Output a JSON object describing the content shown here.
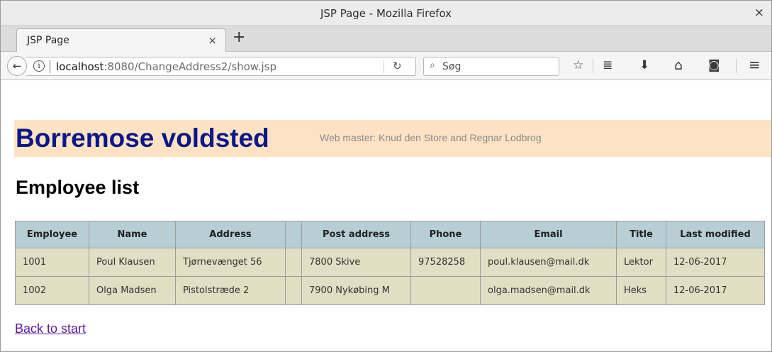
{
  "window": {
    "title": "JSP Page - Mozilla Firefox",
    "close_glyph": "×"
  },
  "tabs": [
    {
      "label": "JSP Page",
      "close_glyph": "×"
    }
  ],
  "new_tab_glyph": "+",
  "navbar": {
    "back_glyph": "←",
    "info_glyph": "i",
    "url_host": "localhost",
    "url_rest": ":8080/ChangeAddress2/show.jsp",
    "reload_glyph": "↻",
    "search_placeholder": "Søg",
    "search_icon": "⌕",
    "icons": {
      "bookmark_star": "☆",
      "reading_list": "≣",
      "downloads": "⬇",
      "home": "⌂",
      "pocket": "◙",
      "menu": "≡"
    }
  },
  "page": {
    "site_title": "Borremose voldsted",
    "webmaster": "Web master: Knud den Store and Regnar Lodbrog",
    "heading": "Employee list",
    "table": {
      "headers": [
        "Employee",
        "Name",
        "Address",
        "",
        "Post address",
        "Phone",
        "Email",
        "Title",
        "Last modified"
      ],
      "rows": [
        [
          "1001",
          "Poul Klausen",
          "Tjørnevænget 56",
          "",
          "7800 Skive",
          "97528258",
          "poul.klausen@mail.dk",
          "Lektor",
          "12-06-2017"
        ],
        [
          "1002",
          "Olga Madsen",
          "Pistolstræde 2",
          "",
          "7900 Nykøbing M",
          "",
          "olga.madsen@mail.dk",
          "Heks",
          "12-06-2017"
        ]
      ]
    },
    "back_link": "Back to start"
  },
  "colors": {
    "banner_bg": "#fde3c3",
    "site_title": "#0b1887",
    "table_header_bg": "#b6ced4",
    "table_row_bg": "#e1dfc3",
    "link": "#5b1a9e"
  }
}
